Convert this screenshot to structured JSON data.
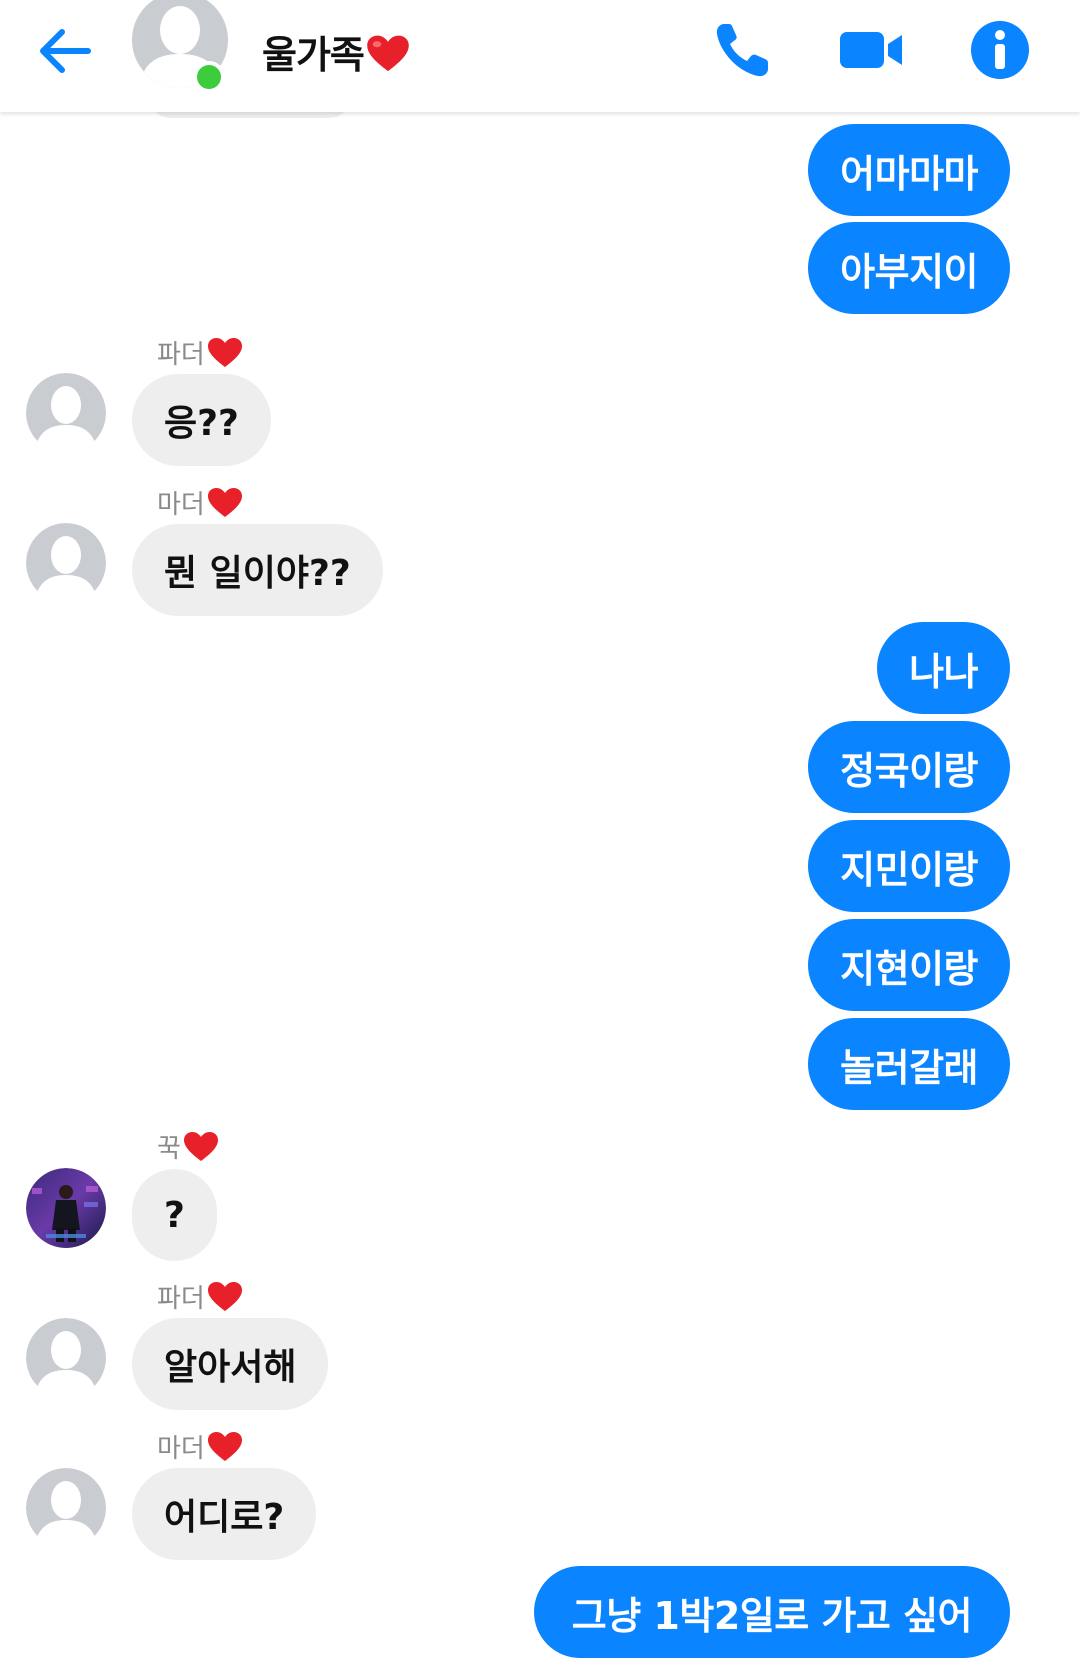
{
  "header": {
    "title": "울가족",
    "icons": [
      "back-arrow-icon",
      "phone-icon",
      "video-camera-icon",
      "info-icon"
    ]
  },
  "messages": [
    {
      "dir": "out",
      "text": "어마마마"
    },
    {
      "dir": "out",
      "text": "아부지이"
    },
    {
      "dir": "in",
      "sender": "파더",
      "text": "응??"
    },
    {
      "dir": "in",
      "sender": "마더",
      "text": "뭔 일이야??"
    },
    {
      "dir": "out",
      "text": "나나"
    },
    {
      "dir": "out",
      "text": "정국이랑"
    },
    {
      "dir": "out",
      "text": "지민이랑"
    },
    {
      "dir": "out",
      "text": "지현이랑"
    },
    {
      "dir": "out",
      "text": "놀러갈래"
    },
    {
      "dir": "in",
      "sender": "꾹",
      "text": "?"
    },
    {
      "dir": "in",
      "sender": "파더",
      "text": "알아서해"
    },
    {
      "dir": "in",
      "sender": "마더",
      "text": "어디로?"
    },
    {
      "dir": "out",
      "text": "그냥 1박2일로 가고 싶어"
    }
  ],
  "colors": {
    "accent": "#0a84ff",
    "incoming_bubble": "#eeeeee",
    "online": "#3ccc3c",
    "heart": "#e8202a"
  }
}
